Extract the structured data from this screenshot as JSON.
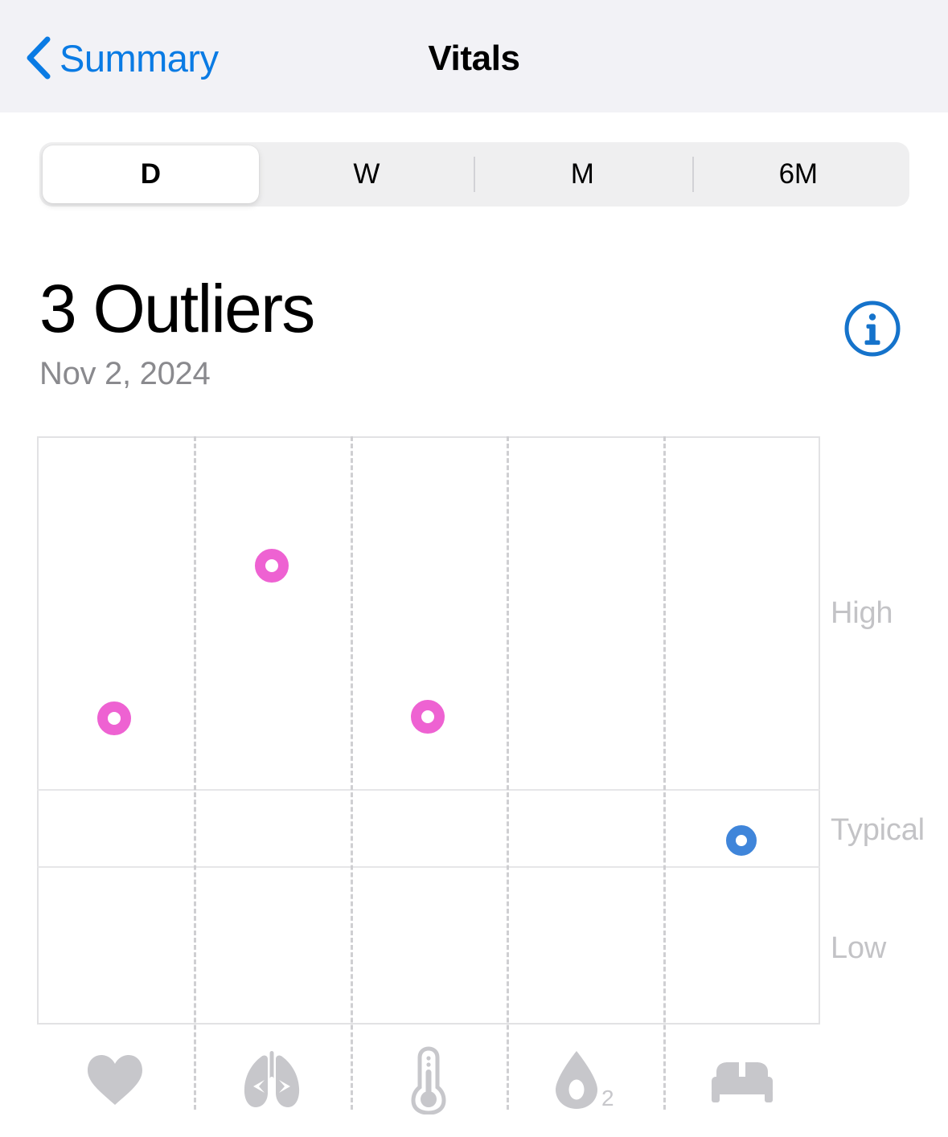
{
  "nav": {
    "back_label": "Summary",
    "back_icon": "chevron-left-icon",
    "title": "Vitals",
    "accent_color": "#0A7BE4"
  },
  "segmented": {
    "options": [
      {
        "label": "D",
        "selected": true
      },
      {
        "label": "W",
        "selected": false
      },
      {
        "label": "M",
        "selected": false
      },
      {
        "label": "6M",
        "selected": false
      }
    ]
  },
  "summary": {
    "headline": "3 Outliers",
    "date": "Nov 2, 2024",
    "info_icon": "info-circle-icon"
  },
  "chart_data": {
    "type": "scatter",
    "title": "3 Outliers",
    "subtitle": "Nov 2, 2024",
    "xlabel": "",
    "ylabel": "",
    "grid": true,
    "legend_position": "right",
    "categories": [
      "Heart Rate",
      "Respiratory Rate",
      "Body Temperature",
      "Blood Oxygen",
      "Sleep"
    ],
    "category_icons": [
      "heart-icon",
      "lungs-icon",
      "thermometer-icon",
      "blood-oxygen-icon",
      "bed-icon"
    ],
    "y_band_labels": [
      "High",
      "Typical",
      "Low"
    ],
    "y_bands": [
      {
        "label": "High",
        "top_pct": 0.0,
        "bottom_pct": 60.0
      },
      {
        "label": "Typical",
        "top_pct": 60.0,
        "bottom_pct": 73.1
      },
      {
        "label": "Low",
        "top_pct": 73.1,
        "bottom_pct": 100.0
      }
    ],
    "points": [
      {
        "category": "Heart Rate",
        "x_pct": 10.0,
        "y_pct": 48.6,
        "band": "High",
        "status": "outlier",
        "color": "#EE62D2"
      },
      {
        "category": "Respiratory Rate",
        "x_pct": 30.1,
        "y_pct": 22.7,
        "band": "High",
        "status": "outlier",
        "color": "#EE62D2"
      },
      {
        "category": "Body Temperature",
        "x_pct": 50.0,
        "y_pct": 48.4,
        "band": "High",
        "status": "outlier",
        "color": "#EE62D2"
      },
      {
        "category": "Sleep",
        "x_pct": 90.0,
        "y_pct": 69.3,
        "band": "Typical",
        "status": "typical",
        "color": "#3F85DA"
      }
    ],
    "outlier_count": 3,
    "outlier_color": "#EE62D2",
    "typical_color": "#3F85DA"
  }
}
